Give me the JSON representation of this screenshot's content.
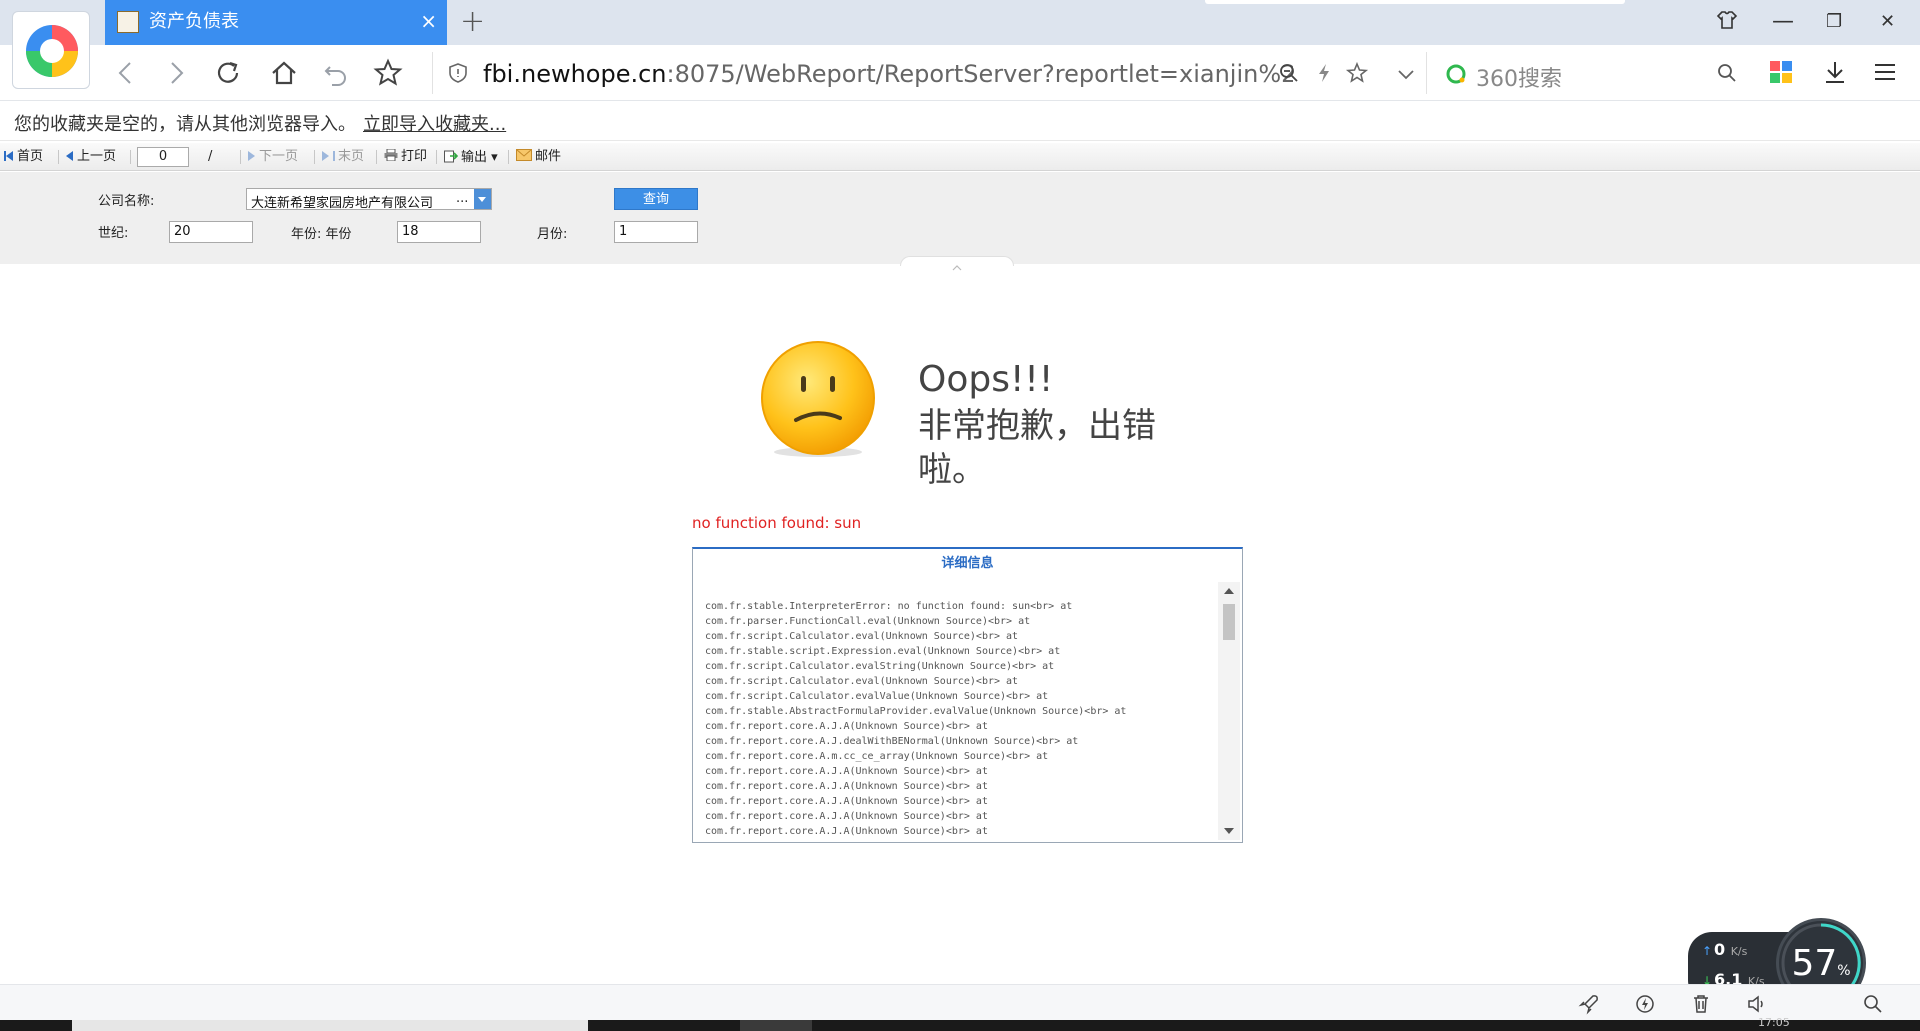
{
  "browser": {
    "tab_title": "资产负债表",
    "tab_close": "×",
    "new_tab": "+",
    "url_domain": "fbi.newhope.cn",
    "url_rest": ":8075/WebReport/ReportServer?reportlet=xianjin%2F%",
    "search_placeholder": "360搜索",
    "window_controls": {
      "minimize": "—",
      "restore": "❐",
      "close": "✕"
    }
  },
  "favorites": {
    "message": "您的收藏夹是空的，请从其他浏览器导入。",
    "import_link": "立即导入收藏夹..."
  },
  "report_toolbar": {
    "first": "首页",
    "prev": "上一页",
    "page_value": "0",
    "slash": "/",
    "next": "下一页",
    "last": "末页",
    "print": "打印",
    "export": "输出",
    "mail": "邮件"
  },
  "params": {
    "company_label": "公司名称:",
    "company_value": "大连新希望家园房地产有限公司",
    "company_more": "...",
    "query_button": "查询",
    "century_label": "世纪:",
    "century_value": "20",
    "year_label": "年份: 年份",
    "year_value": "18",
    "month_label": "月份:",
    "month_value": "1"
  },
  "error": {
    "title": "Oops!!!",
    "subtitle": "非常抱歉，出错啦。",
    "message": "no function found: sun",
    "detail_header": "详细信息",
    "stack": [
      "com.fr.stable.InterpreterError: no function found: sun<br> at",
      "com.fr.parser.FunctionCall.eval(Unknown Source)<br> at",
      "com.fr.script.Calculator.eval(Unknown Source)<br> at",
      "com.fr.stable.script.Expression.eval(Unknown Source)<br> at",
      "com.fr.script.Calculator.evalString(Unknown Source)<br> at",
      "com.fr.script.Calculator.eval(Unknown Source)<br> at",
      "com.fr.script.Calculator.evalValue(Unknown Source)<br> at",
      "com.fr.stable.AbstractFormulaProvider.evalValue(Unknown Source)<br> at",
      "com.fr.report.core.A.J.A(Unknown Source)<br> at",
      "com.fr.report.core.A.J.dealWithBENormal(Unknown Source)<br> at",
      "com.fr.report.core.A.m.cc_ce_array(Unknown Source)<br> at",
      "com.fr.report.core.A.J.A(Unknown Source)<br> at",
      "com.fr.report.core.A.J.A(Unknown Source)<br> at",
      "com.fr.report.core.A.J.A(Unknown Source)<br> at",
      "com.fr.report.core.A.J.A(Unknown Source)<br> at",
      "com.fr.report.core.A.J.A(Unknown Source)<br> at"
    ]
  },
  "speed_widget": {
    "upload_value": "0",
    "upload_unit": "K/s",
    "download_value": "6.1",
    "download_unit": "K/s",
    "percent": "57",
    "percent_unit": "%"
  },
  "taskbar": {
    "clock": "17:05"
  },
  "colors": {
    "tab_active": "#3a8ef0",
    "accent_blue": "#2b6cc4",
    "error_red": "#e02222",
    "query_button": "#3d8fe6"
  }
}
